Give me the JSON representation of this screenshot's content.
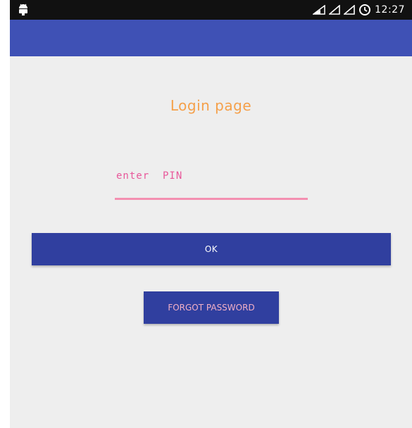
{
  "status_bar": {
    "time": "12:27",
    "left_icon": "android-icon",
    "right_icons": [
      "signal-outline-icon",
      "signal-icon",
      "signal-icon",
      "alarm-icon"
    ]
  },
  "login": {
    "title": "Login page",
    "pin_placeholder": "enter  PIN",
    "pin_value": "",
    "ok_label": "OK",
    "forgot_label": "FORGOT PASSWORD"
  },
  "colors": {
    "status_bar": "#111111",
    "app_bar": "#3f51b5",
    "background": "#eeeeee",
    "title": "#f5a04a",
    "input_underline": "#f48fb1",
    "placeholder": "#e8589a",
    "button": "#303f9f",
    "ok_text": "#ffffff",
    "forgot_text": "#f3b0c6"
  }
}
